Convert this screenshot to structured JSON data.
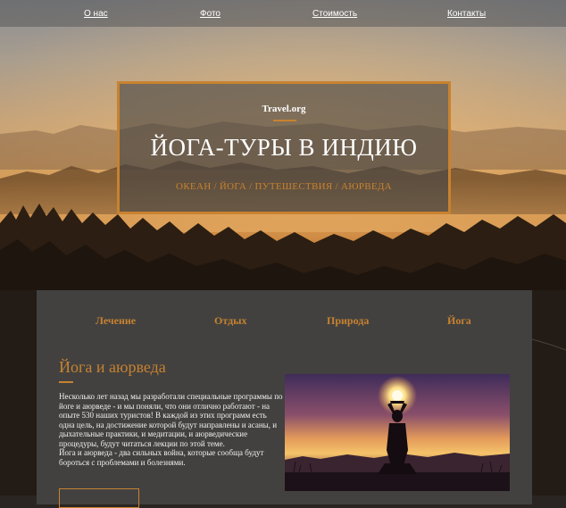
{
  "nav": {
    "items": [
      "О нас",
      "Фото",
      "Стоимость",
      "Контакты"
    ]
  },
  "hero": {
    "brand": "Travel.org",
    "title": "ЙОГА-ТУРЫ В ИНДИЮ",
    "tags": "ОКЕАН / ЙОГА / ПУТЕШЕСТВИЯ / АЮРВЕДА"
  },
  "tabs": [
    "Лечение",
    "Отдых",
    "Природа",
    "Йога"
  ],
  "section": {
    "title": "Йога и аюрведа",
    "paragraph1": "Несколько лет назад мы разработали специальные программы по йоге и аюрведе - и мы поняли, что они отлично работают - на опыте 530 наших туристов! В каждой из этих программ есть одна цель, на достижение которой будут направлены и асаны, и дыхательные практики, и медитации, и аюрведические процедуры, будут читаться лекции по этой теме.",
    "paragraph2": "Йога и аюрведа - два сильных война, которые сообща будут бороться с проблемами и болезнями."
  },
  "colors": {
    "accent": "#c8822f",
    "panel": "#424140",
    "nav_overlay": "#5a5a5a"
  },
  "icons": {
    "photo": "yoga-silhouette-sunset-image"
  }
}
